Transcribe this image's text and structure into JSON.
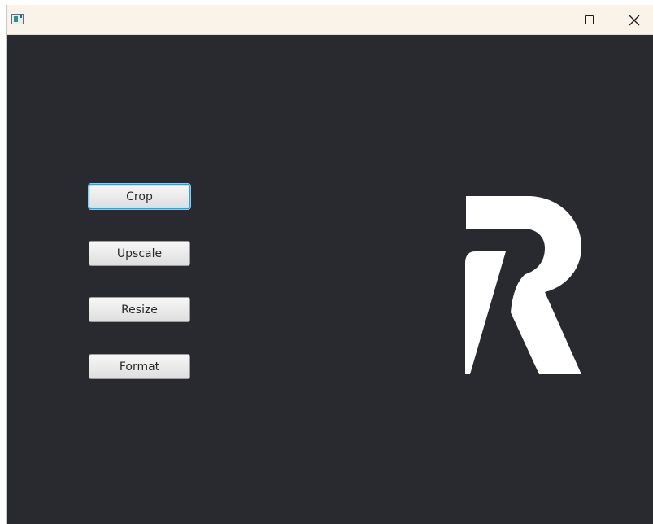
{
  "window": {
    "title": "",
    "controls": {
      "minimize": "minimize-icon",
      "maximize": "maximize-icon",
      "close": "close-icon"
    },
    "colors": {
      "titlebar": "#f9f3ea",
      "background": "#292930"
    }
  },
  "menu": {
    "buttons": [
      {
        "label": "Crop",
        "focused": true
      },
      {
        "label": "Upscale",
        "focused": false
      },
      {
        "label": "Resize",
        "focused": false
      },
      {
        "label": "Format",
        "focused": false
      }
    ]
  },
  "logo": {
    "icon": "r-logo-icon",
    "color": "#ffffff"
  }
}
